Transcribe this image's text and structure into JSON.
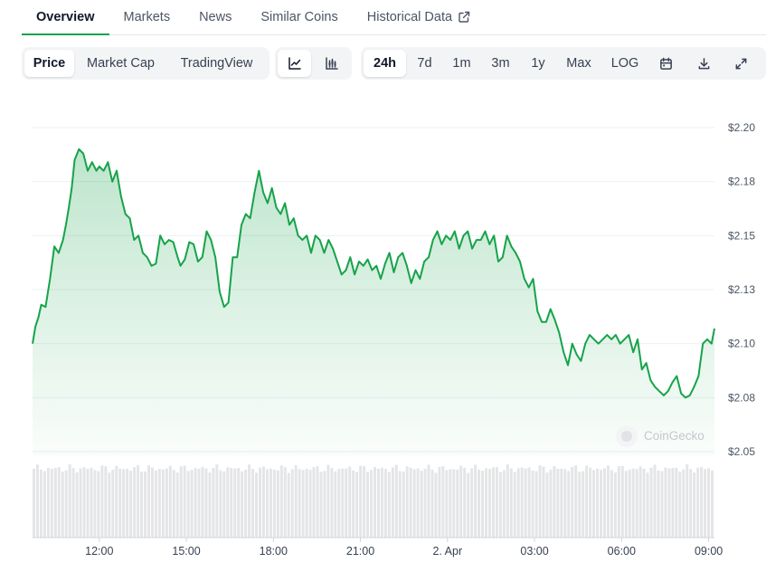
{
  "tabs": [
    {
      "label": "Overview",
      "active": true
    },
    {
      "label": "Markets"
    },
    {
      "label": "News"
    },
    {
      "label": "Similar Coins"
    },
    {
      "label": "Historical Data",
      "icon": "external-link-icon"
    }
  ],
  "toolbar": {
    "chart_modes": [
      "Price",
      "Market Cap",
      "TradingView"
    ],
    "active_mode": "Price",
    "chart_types": [
      "line-chart-icon",
      "candlestick-chart-icon"
    ],
    "active_type": "line-chart-icon",
    "ranges": [
      "24h",
      "7d",
      "1m",
      "3m",
      "1y",
      "Max",
      "LOG"
    ],
    "active_range": "24h",
    "tools": [
      "calendar-icon",
      "download-icon",
      "fullscreen-icon"
    ]
  },
  "watermark": "CoinGecko",
  "colors": {
    "line": "#16a34a",
    "grid": "#eef0f2",
    "volume": "#e4e5e7"
  },
  "chart_data": {
    "type": "area",
    "x_tick_labels": [
      "12:00",
      "15:00",
      "18:00",
      "21:00",
      "2. Apr",
      "03:00",
      "06:00",
      "09:00"
    ],
    "x_tick_hours": [
      12,
      15,
      18,
      21,
      24,
      27,
      30,
      33
    ],
    "x_range_hours": [
      9.7,
      33.2
    ],
    "y_tick_labels": [
      "$2.05",
      "$2.08",
      "$2.10",
      "$2.13",
      "$2.15",
      "$2.18",
      "$2.20"
    ],
    "y_tick_values": [
      2.05,
      2.075,
      2.1,
      2.125,
      2.15,
      2.175,
      2.2
    ],
    "ylim": [
      2.05,
      2.2
    ],
    "grid": true,
    "series": [
      {
        "x_hours": [
          9.7,
          9.8,
          9.9,
          10.0,
          10.15,
          10.3,
          10.45,
          10.6,
          10.75,
          10.85,
          10.95,
          11.05,
          11.15,
          11.3,
          11.45,
          11.6,
          11.75,
          11.9,
          12.0,
          12.15,
          12.3,
          12.45,
          12.6,
          12.75,
          12.9,
          13.05,
          13.2,
          13.35,
          13.5,
          13.65,
          13.8,
          13.95,
          14.1,
          14.25,
          14.4,
          14.55,
          14.7,
          14.8,
          14.95,
          15.1,
          15.25,
          15.4,
          15.55,
          15.7,
          15.85,
          16.0,
          16.15,
          16.3,
          16.45,
          16.6,
          16.75,
          16.9,
          17.05,
          17.2,
          17.35,
          17.5,
          17.65,
          17.8,
          17.95,
          18.1,
          18.25,
          18.4,
          18.55,
          18.7,
          18.85,
          19.0,
          19.15,
          19.3,
          19.45,
          19.6,
          19.75,
          19.9,
          20.05,
          20.2,
          20.35,
          20.5,
          20.65,
          20.8,
          20.95,
          21.1,
          21.25,
          21.4,
          21.55,
          21.7,
          21.85,
          22.0,
          22.15,
          22.3,
          22.45,
          22.6,
          22.75,
          22.9,
          23.05,
          23.2,
          23.35,
          23.5,
          23.65,
          23.8,
          23.95,
          24.1,
          24.25,
          24.4,
          24.55,
          24.7,
          24.85,
          25.0,
          25.15,
          25.3,
          25.45,
          25.6,
          25.75,
          25.9,
          26.05,
          26.2,
          26.35,
          26.5,
          26.65,
          26.8,
          26.95,
          27.1,
          27.25,
          27.4,
          27.55,
          27.7,
          27.85,
          28.0,
          28.15,
          28.3,
          28.45,
          28.6,
          28.75,
          28.9,
          29.05,
          29.2,
          29.35,
          29.5,
          29.65,
          29.8,
          29.95,
          30.1,
          30.25,
          30.4,
          30.55,
          30.7,
          30.85,
          31.0,
          31.15,
          31.3,
          31.45,
          31.6,
          31.75,
          31.9,
          32.05,
          32.2,
          32.35,
          32.5,
          32.65,
          32.8,
          32.95,
          33.1,
          33.2
        ],
        "values": [
          2.1,
          2.108,
          2.112,
          2.118,
          2.117,
          2.13,
          2.145,
          2.142,
          2.148,
          2.155,
          2.163,
          2.172,
          2.185,
          2.19,
          2.188,
          2.18,
          2.184,
          2.18,
          2.182,
          2.18,
          2.184,
          2.175,
          2.18,
          2.168,
          2.16,
          2.158,
          2.148,
          2.15,
          2.142,
          2.14,
          2.136,
          2.137,
          2.15,
          2.146,
          2.148,
          2.147,
          2.14,
          2.136,
          2.139,
          2.147,
          2.146,
          2.138,
          2.14,
          2.152,
          2.148,
          2.14,
          2.124,
          2.117,
          2.119,
          2.14,
          2.14,
          2.155,
          2.16,
          2.158,
          2.17,
          2.18,
          2.17,
          2.165,
          2.172,
          2.163,
          2.16,
          2.165,
          2.155,
          2.158,
          2.15,
          2.148,
          2.15,
          2.142,
          2.15,
          2.148,
          2.142,
          2.148,
          2.144,
          2.138,
          2.132,
          2.134,
          2.14,
          2.132,
          2.138,
          2.136,
          2.139,
          2.134,
          2.136,
          2.13,
          2.137,
          2.142,
          2.133,
          2.14,
          2.142,
          2.136,
          2.128,
          2.134,
          2.13,
          2.138,
          2.14,
          2.148,
          2.152,
          2.146,
          2.15,
          2.148,
          2.152,
          2.144,
          2.15,
          2.152,
          2.144,
          2.148,
          2.148,
          2.152,
          2.146,
          2.15,
          2.138,
          2.14,
          2.15,
          2.145,
          2.142,
          2.138,
          2.13,
          2.126,
          2.13,
          2.115,
          2.11,
          2.11,
          2.116,
          2.111,
          2.105,
          2.096,
          2.09,
          2.1,
          2.095,
          2.092,
          2.1,
          2.104,
          2.102,
          2.1,
          2.102,
          2.104,
          2.102,
          2.104,
          2.1,
          2.102,
          2.104,
          2.096,
          2.102,
          2.088,
          2.091,
          2.083,
          2.08,
          2.078,
          2.076,
          2.078,
          2.082,
          2.085,
          2.077,
          2.075,
          2.076,
          2.08,
          2.085,
          2.1,
          2.102,
          2.1,
          2.107,
          2.105,
          2.106
        ]
      }
    ],
    "volume": {
      "bars": 190,
      "min": 0.88,
      "max": 1.0
    }
  }
}
